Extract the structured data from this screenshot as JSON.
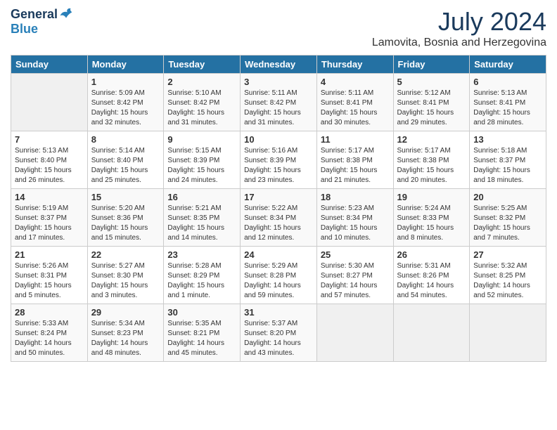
{
  "logo": {
    "general": "General",
    "blue": "Blue"
  },
  "title": "July 2024",
  "location": "Lamovita, Bosnia and Herzegovina",
  "days_header": [
    "Sunday",
    "Monday",
    "Tuesday",
    "Wednesday",
    "Thursday",
    "Friday",
    "Saturday"
  ],
  "weeks": [
    [
      {
        "num": "",
        "info": ""
      },
      {
        "num": "1",
        "info": "Sunrise: 5:09 AM\nSunset: 8:42 PM\nDaylight: 15 hours\nand 32 minutes."
      },
      {
        "num": "2",
        "info": "Sunrise: 5:10 AM\nSunset: 8:42 PM\nDaylight: 15 hours\nand 31 minutes."
      },
      {
        "num": "3",
        "info": "Sunrise: 5:11 AM\nSunset: 8:42 PM\nDaylight: 15 hours\nand 31 minutes."
      },
      {
        "num": "4",
        "info": "Sunrise: 5:11 AM\nSunset: 8:41 PM\nDaylight: 15 hours\nand 30 minutes."
      },
      {
        "num": "5",
        "info": "Sunrise: 5:12 AM\nSunset: 8:41 PM\nDaylight: 15 hours\nand 29 minutes."
      },
      {
        "num": "6",
        "info": "Sunrise: 5:13 AM\nSunset: 8:41 PM\nDaylight: 15 hours\nand 28 minutes."
      }
    ],
    [
      {
        "num": "7",
        "info": "Sunrise: 5:13 AM\nSunset: 8:40 PM\nDaylight: 15 hours\nand 26 minutes."
      },
      {
        "num": "8",
        "info": "Sunrise: 5:14 AM\nSunset: 8:40 PM\nDaylight: 15 hours\nand 25 minutes."
      },
      {
        "num": "9",
        "info": "Sunrise: 5:15 AM\nSunset: 8:39 PM\nDaylight: 15 hours\nand 24 minutes."
      },
      {
        "num": "10",
        "info": "Sunrise: 5:16 AM\nSunset: 8:39 PM\nDaylight: 15 hours\nand 23 minutes."
      },
      {
        "num": "11",
        "info": "Sunrise: 5:17 AM\nSunset: 8:38 PM\nDaylight: 15 hours\nand 21 minutes."
      },
      {
        "num": "12",
        "info": "Sunrise: 5:17 AM\nSunset: 8:38 PM\nDaylight: 15 hours\nand 20 minutes."
      },
      {
        "num": "13",
        "info": "Sunrise: 5:18 AM\nSunset: 8:37 PM\nDaylight: 15 hours\nand 18 minutes."
      }
    ],
    [
      {
        "num": "14",
        "info": "Sunrise: 5:19 AM\nSunset: 8:37 PM\nDaylight: 15 hours\nand 17 minutes."
      },
      {
        "num": "15",
        "info": "Sunrise: 5:20 AM\nSunset: 8:36 PM\nDaylight: 15 hours\nand 15 minutes."
      },
      {
        "num": "16",
        "info": "Sunrise: 5:21 AM\nSunset: 8:35 PM\nDaylight: 15 hours\nand 14 minutes."
      },
      {
        "num": "17",
        "info": "Sunrise: 5:22 AM\nSunset: 8:34 PM\nDaylight: 15 hours\nand 12 minutes."
      },
      {
        "num": "18",
        "info": "Sunrise: 5:23 AM\nSunset: 8:34 PM\nDaylight: 15 hours\nand 10 minutes."
      },
      {
        "num": "19",
        "info": "Sunrise: 5:24 AM\nSunset: 8:33 PM\nDaylight: 15 hours\nand 8 minutes."
      },
      {
        "num": "20",
        "info": "Sunrise: 5:25 AM\nSunset: 8:32 PM\nDaylight: 15 hours\nand 7 minutes."
      }
    ],
    [
      {
        "num": "21",
        "info": "Sunrise: 5:26 AM\nSunset: 8:31 PM\nDaylight: 15 hours\nand 5 minutes."
      },
      {
        "num": "22",
        "info": "Sunrise: 5:27 AM\nSunset: 8:30 PM\nDaylight: 15 hours\nand 3 minutes."
      },
      {
        "num": "23",
        "info": "Sunrise: 5:28 AM\nSunset: 8:29 PM\nDaylight: 15 hours\nand 1 minute."
      },
      {
        "num": "24",
        "info": "Sunrise: 5:29 AM\nSunset: 8:28 PM\nDaylight: 14 hours\nand 59 minutes."
      },
      {
        "num": "25",
        "info": "Sunrise: 5:30 AM\nSunset: 8:27 PM\nDaylight: 14 hours\nand 57 minutes."
      },
      {
        "num": "26",
        "info": "Sunrise: 5:31 AM\nSunset: 8:26 PM\nDaylight: 14 hours\nand 54 minutes."
      },
      {
        "num": "27",
        "info": "Sunrise: 5:32 AM\nSunset: 8:25 PM\nDaylight: 14 hours\nand 52 minutes."
      }
    ],
    [
      {
        "num": "28",
        "info": "Sunrise: 5:33 AM\nSunset: 8:24 PM\nDaylight: 14 hours\nand 50 minutes."
      },
      {
        "num": "29",
        "info": "Sunrise: 5:34 AM\nSunset: 8:23 PM\nDaylight: 14 hours\nand 48 minutes."
      },
      {
        "num": "30",
        "info": "Sunrise: 5:35 AM\nSunset: 8:21 PM\nDaylight: 14 hours\nand 45 minutes."
      },
      {
        "num": "31",
        "info": "Sunrise: 5:37 AM\nSunset: 8:20 PM\nDaylight: 14 hours\nand 43 minutes."
      },
      {
        "num": "",
        "info": ""
      },
      {
        "num": "",
        "info": ""
      },
      {
        "num": "",
        "info": ""
      }
    ]
  ]
}
